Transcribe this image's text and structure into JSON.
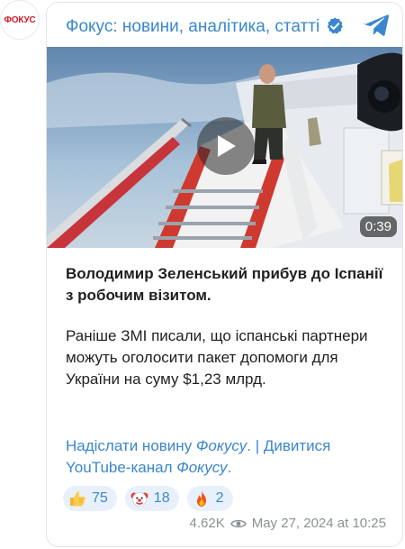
{
  "channel": {
    "avatar_text": "ФОКУС",
    "title": "Фокус: новини, аналітика, статті",
    "verified_icon": "verified-icon",
    "telegram_icon": "telegram-icon"
  },
  "video": {
    "duration": "0:39",
    "play_icon": "play-icon"
  },
  "post": {
    "headline": "Володимир Зеленський прибув до Іспанії з робочим візитом.",
    "body": "Раніше ЗМІ писали, що іспанські партнери можуть оголосити пакет допомоги для України на суму $1,23 млрд."
  },
  "links": {
    "send_news_prefix": "Надіслати новину ",
    "send_news_em": "Фокусу",
    "send_news_suffix": ".",
    "separator": " | ",
    "youtube_prefix": "Дивитися YouTube-канал ",
    "youtube_em": "Фокусу",
    "youtube_suffix": "."
  },
  "reactions": [
    {
      "emoji": "thumbs-up",
      "count": "75"
    },
    {
      "emoji": "clown-face",
      "count": "18"
    },
    {
      "emoji": "fire",
      "count": "2"
    }
  ],
  "meta": {
    "views": "4.62K",
    "views_icon": "eye-icon",
    "date": "May 27, 2024 at 10:25"
  },
  "colors": {
    "accent": "#3a87cf",
    "reaction_bg": "#e8f1fb",
    "meta_text": "#8b8f94",
    "brand_red": "#d31b24"
  }
}
